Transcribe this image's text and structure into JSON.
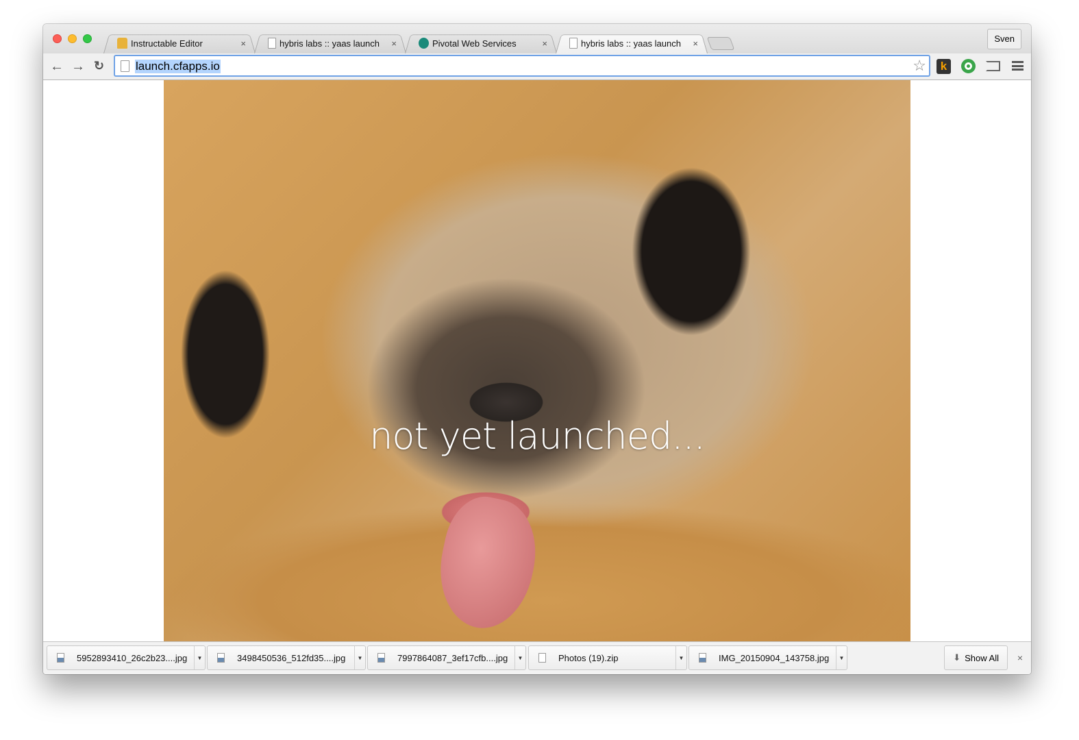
{
  "browser": {
    "tabs": [
      {
        "title": "Instructable Editor",
        "icon": "instructables-robot-icon",
        "active": false
      },
      {
        "title": "hybris labs :: yaas launch",
        "icon": "page-icon",
        "active": false
      },
      {
        "title": "Pivotal Web Services",
        "icon": "pivotal-icon",
        "active": false
      },
      {
        "title": "hybris labs :: yaas launch",
        "icon": "page-icon",
        "active": true
      }
    ],
    "close_glyph": "×",
    "user": "Sven",
    "url": "launch.cfapps.io",
    "ext_k": "k"
  },
  "page": {
    "caption": "not yet launched..."
  },
  "downloads": {
    "items": [
      {
        "name": "5952893410_26c2b23....jpg",
        "type": "image"
      },
      {
        "name": "3498450536_512fd35....jpg",
        "type": "image"
      },
      {
        "name": "7997864087_3ef17cfb....jpg",
        "type": "image"
      },
      {
        "name": "Photos (19).zip",
        "type": "zip"
      },
      {
        "name": "IMG_20150904_143758.jpg",
        "type": "image"
      }
    ],
    "dropdown_glyph": "▼",
    "show_all": "Show All",
    "close_glyph": "×"
  },
  "colors": {
    "accent": "#6fa2e6",
    "selection": "#b3d4fd"
  }
}
